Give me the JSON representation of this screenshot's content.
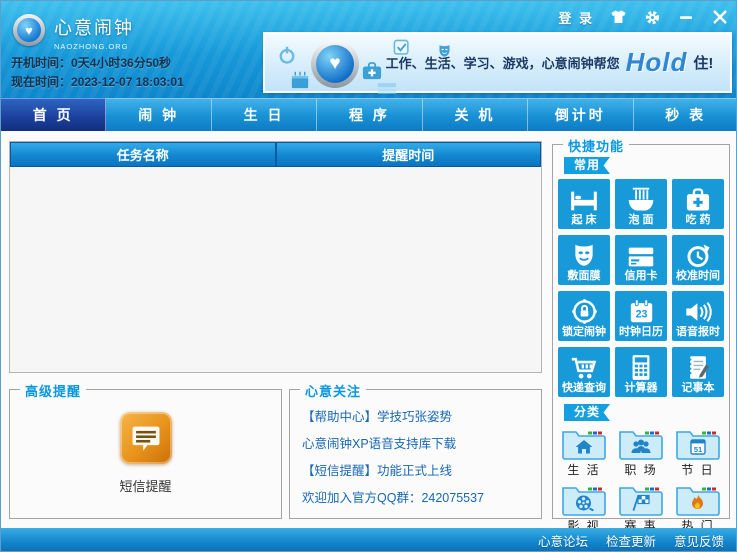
{
  "titlebar": {
    "login": "登 录",
    "skin_icon": "shirt-icon",
    "settings_icon": "gear-icon",
    "minimize_icon": "minimize-icon",
    "close_icon": "close-icon"
  },
  "logo": {
    "title": "心意闹钟",
    "subtitle": "NAOZHONG.ORG"
  },
  "status": {
    "boot_label": "开机时间：",
    "boot_value": "0天4小时36分50秒",
    "now_label": "现在时间：",
    "now_value": "2023-12-07 18:03:01"
  },
  "banner": {
    "tagline_prefix": "工作、生活、学习、游戏，心意闹钟帮您",
    "tagline_highlight": "Hold",
    "tagline_suffix": "住!"
  },
  "tabs": [
    {
      "label": "首 页",
      "active": true
    },
    {
      "label": "闹 钟",
      "active": false
    },
    {
      "label": "生 日",
      "active": false
    },
    {
      "label": "程 序",
      "active": false
    },
    {
      "label": "关 机",
      "active": false
    },
    {
      "label": "倒计时",
      "active": false
    },
    {
      "label": "秒 表",
      "active": false
    }
  ],
  "task_table": {
    "columns": [
      "任务名称",
      "提醒时间"
    ],
    "rows": []
  },
  "quick_panel": {
    "title": "快捷功能",
    "common_badge": "常用",
    "common_buttons": [
      {
        "label": "起 床",
        "icon": "bed-icon"
      },
      {
        "label": "泡 面",
        "icon": "noodles-icon"
      },
      {
        "label": "吃 药",
        "icon": "medkit-icon"
      },
      {
        "label": "敷面膜",
        "icon": "face-mask-icon"
      },
      {
        "label": "信用卡",
        "icon": "credit-card-icon"
      },
      {
        "label": "校准时间",
        "icon": "clock-sync-icon"
      },
      {
        "label": "锁定闹钟",
        "icon": "lock-icon"
      },
      {
        "label": "时钟日历",
        "icon": "calendar-icon",
        "icon_text": "23"
      },
      {
        "label": "语音报时",
        "icon": "speaker-icon"
      },
      {
        "label": "快递查询",
        "icon": "cart-icon"
      },
      {
        "label": "计算器",
        "icon": "calculator-icon"
      },
      {
        "label": "记事本",
        "icon": "notepad-icon"
      }
    ],
    "category_badge": "分类",
    "category_folders": [
      {
        "label": "生 活",
        "icon": "home-folder-icon"
      },
      {
        "label": "职 场",
        "icon": "people-folder-icon"
      },
      {
        "label": "节 日",
        "icon": "calendar-folder-icon",
        "icon_text": "51"
      },
      {
        "label": "影 视",
        "icon": "film-folder-icon"
      },
      {
        "label": "赛 事",
        "icon": "flag-folder-icon"
      },
      {
        "label": "热 门",
        "icon": "flame-folder-icon"
      }
    ]
  },
  "advanced_panel": {
    "title": "高级提醒",
    "sms_button": "短信提醒"
  },
  "focus_panel": {
    "title": "心意关注",
    "links": [
      "【帮助中心】学技巧张姿势",
      "心意闹钟XP语音支持库下载",
      "【短信提醒】功能正式上线",
      "欢迎加入官方QQ群：242075537"
    ]
  },
  "footer": {
    "links": [
      "心意论坛",
      "检查更新",
      "意见反馈"
    ]
  },
  "colors": {
    "accent_blue": "#1899d8",
    "header_top": "#3ec0ee",
    "header_bottom": "#0e86cc",
    "tab_active": "#1b3f9a",
    "panel_title_blue": "#0998e0",
    "link_blue": "#1767b5",
    "sms_orange": "#e8931c",
    "folder_fill": "#cdecfa",
    "folder_stroke": "#3fa8e0"
  }
}
